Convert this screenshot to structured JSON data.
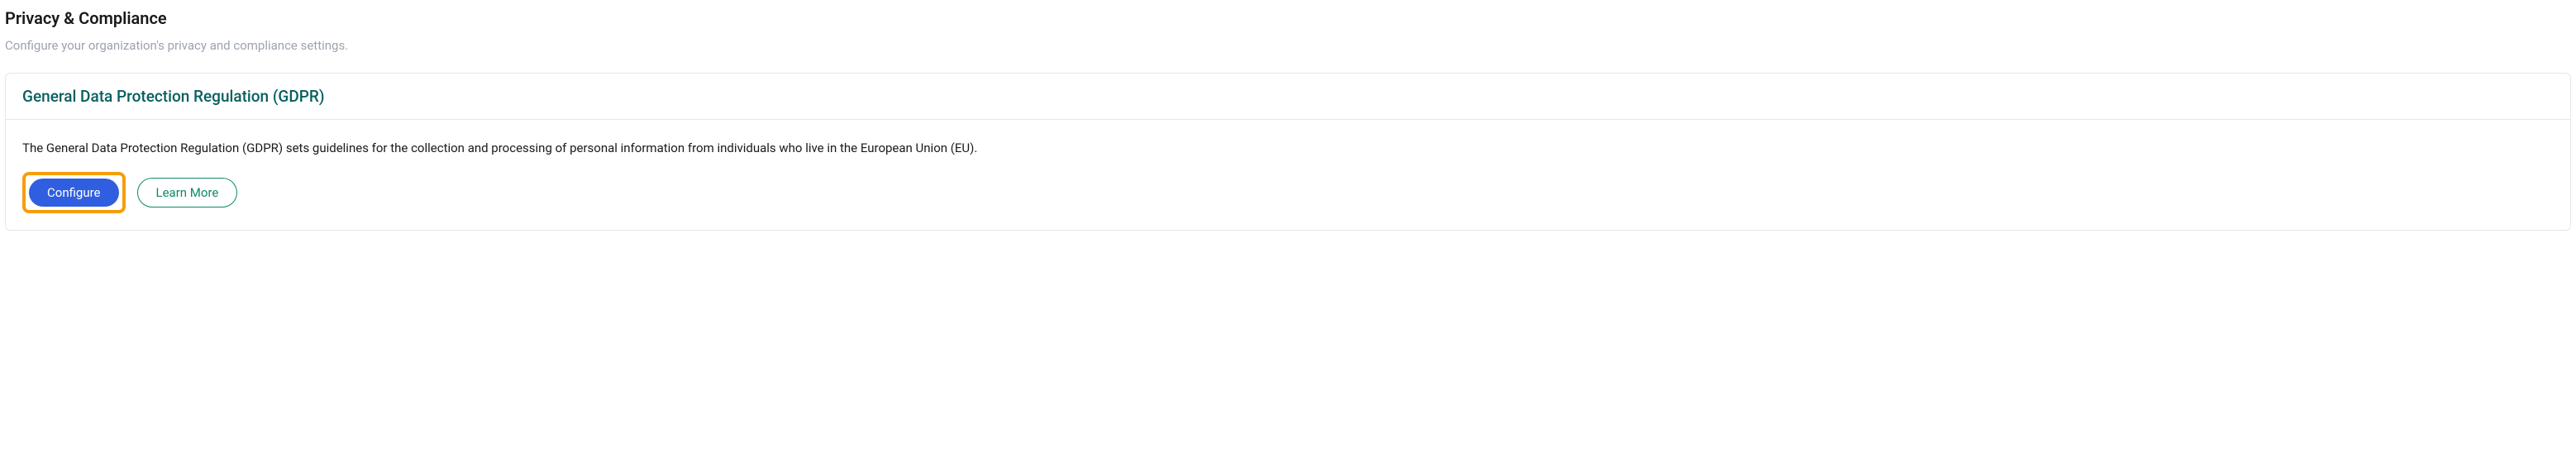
{
  "header": {
    "title": "Privacy & Compliance",
    "subtitle": "Configure your organization's privacy and compliance settings."
  },
  "card": {
    "title": "General Data Protection Regulation (GDPR)",
    "description": "The General Data Protection Regulation (GDPR) sets guidelines for the collection and processing of personal information from individuals who live in the European Union (EU).",
    "configure_label": "Configure",
    "learn_more_label": "Learn More"
  }
}
